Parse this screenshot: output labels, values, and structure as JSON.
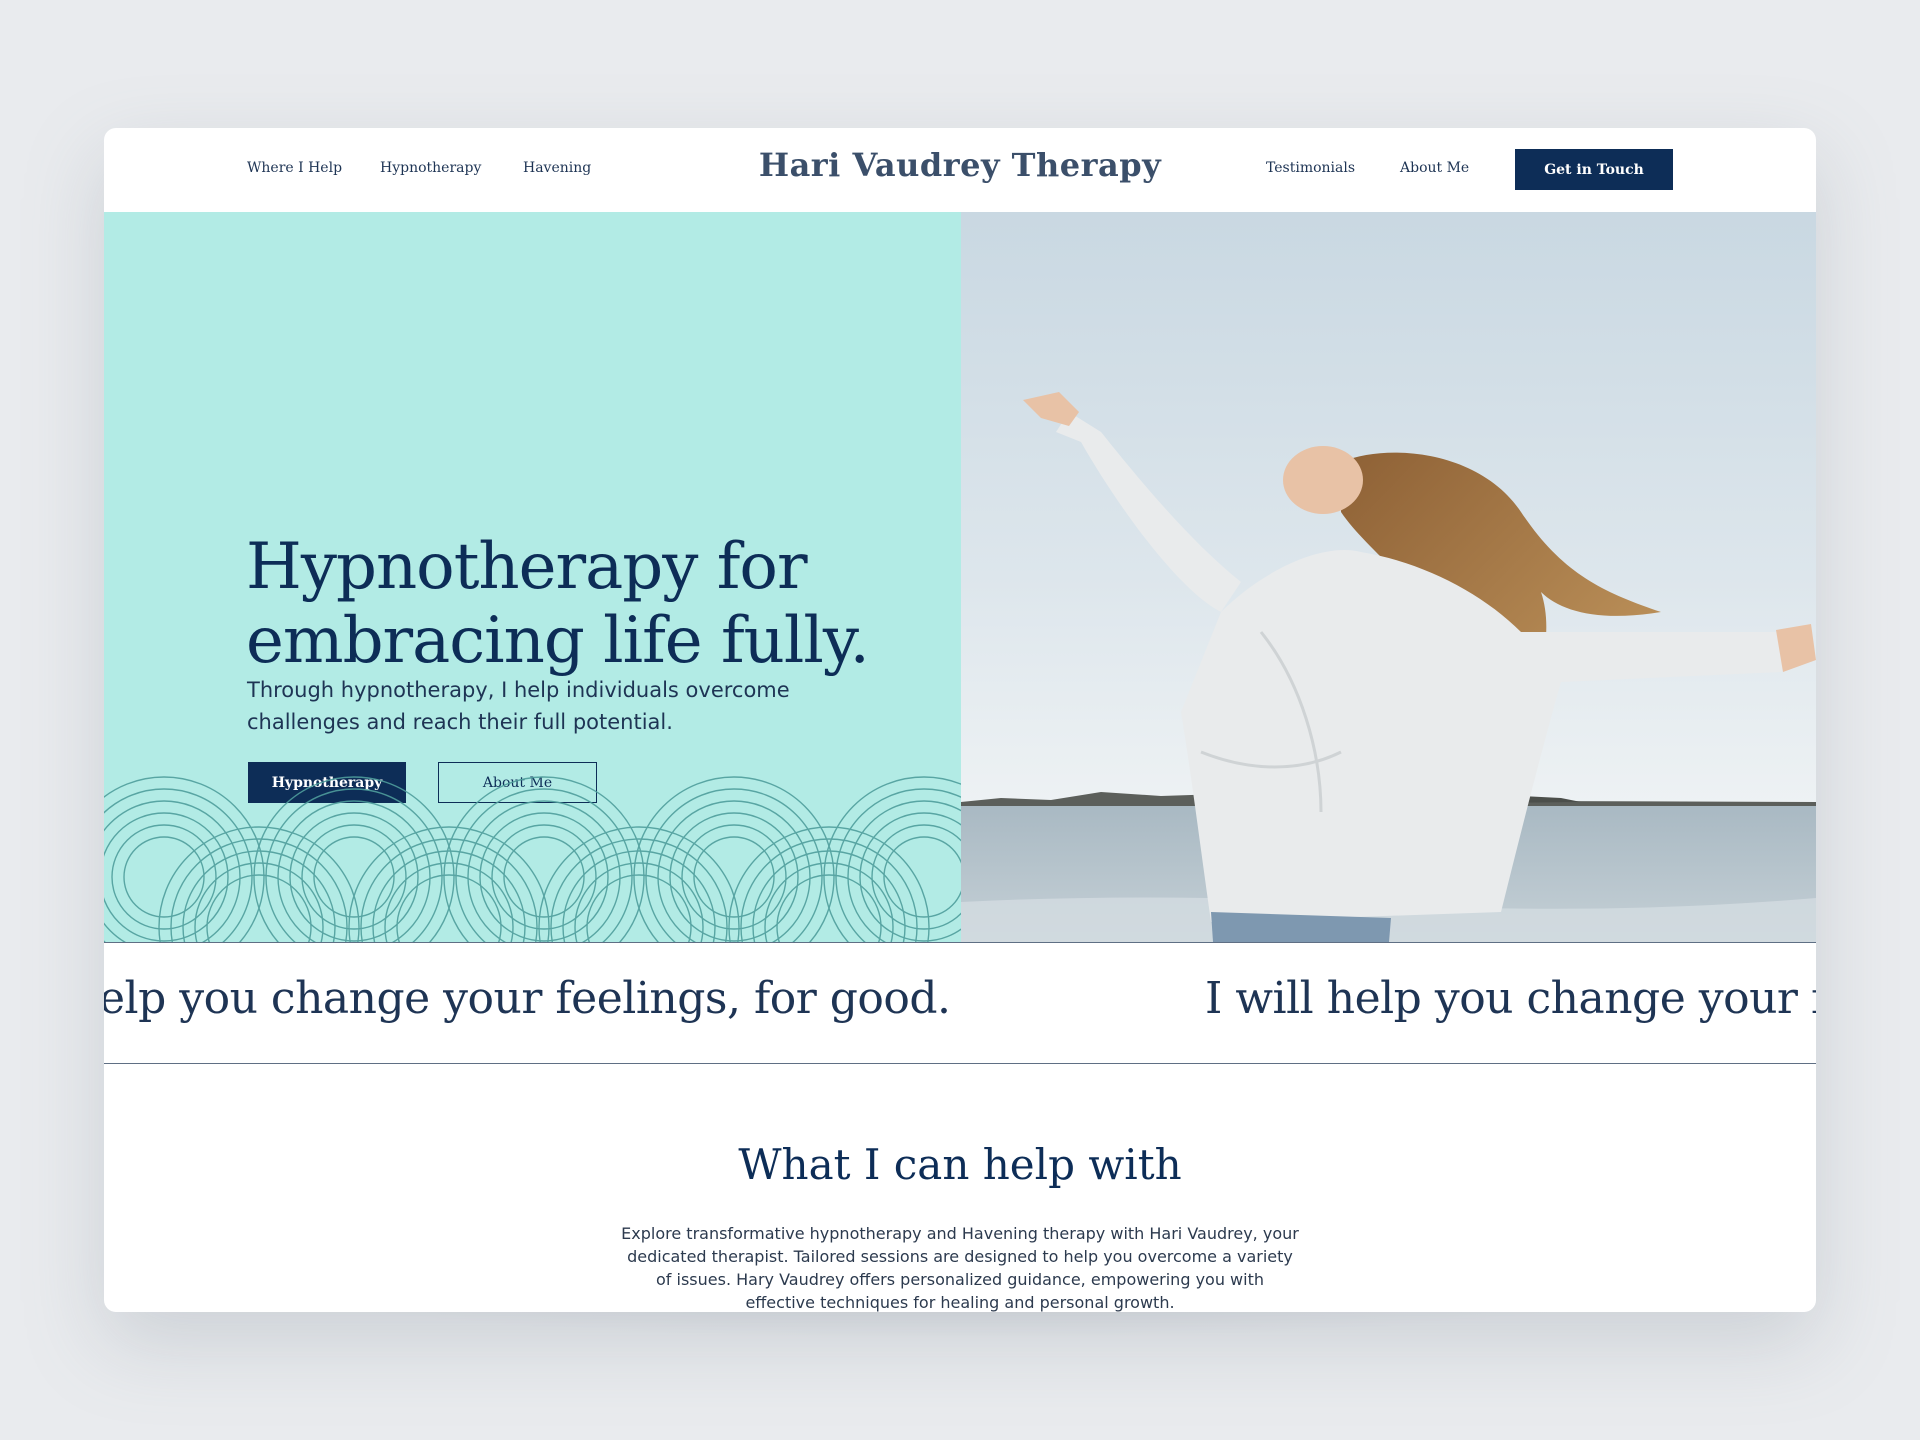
{
  "nav": {
    "left_links": [
      "Where I Help",
      "Hypnotherapy",
      "Havening"
    ],
    "brand": "Hari Vaudrey Therapy",
    "right_links": [
      "Testimonials",
      "About Me"
    ],
    "cta_label": "Get in Touch"
  },
  "hero": {
    "title_line1": "Hypnotherapy for",
    "title_line2": "embracing life fully.",
    "subtitle": "Through hypnotherapy, I help individuals overcome challenges and reach their full potential.",
    "primary_button": "Hypnotherapy",
    "secondary_button": "About Me"
  },
  "marquee": {
    "text_left": "elp you change your feelings, for good.",
    "text_right": "I will help you change your fee"
  },
  "help_section": {
    "title": "What I can help with",
    "description": "Explore transformative hypnotherapy and Havening therapy with Hari Vaudrey, your dedicated therapist. Tailored sessions are designed to help you overcome a variety of issues. Hary Vaudrey offers personalized guidance, empowering you with effective techniques for healing and personal growth."
  },
  "colors": {
    "navy": "#0d2d57",
    "mint": "#b2ebe5",
    "wave_stroke": "#4f9e9c",
    "page_bg": "#e9ebee"
  }
}
